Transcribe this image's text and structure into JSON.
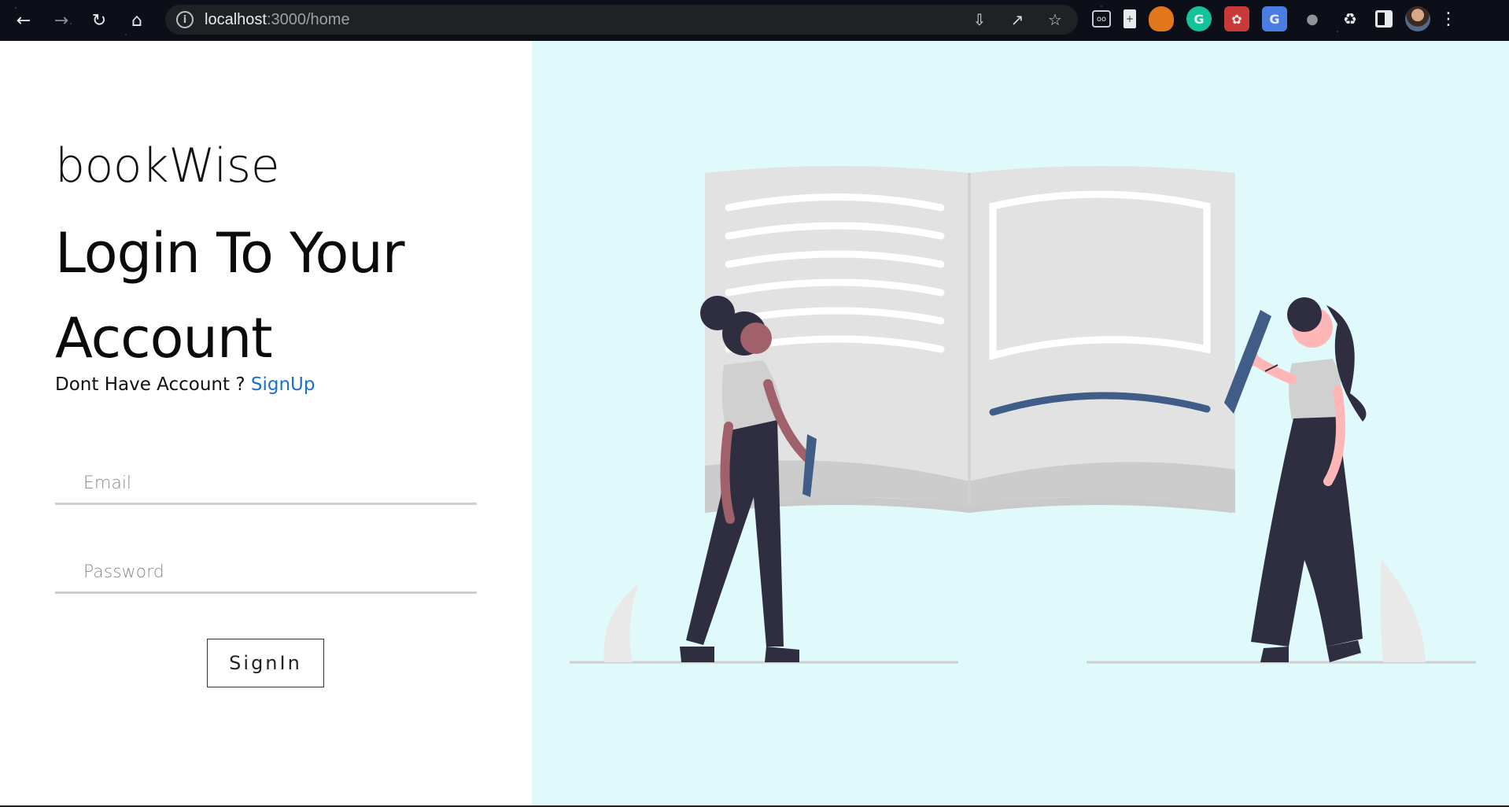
{
  "browser": {
    "url_host": "localhost",
    "url_path": ":3000/home",
    "extensions": [
      "reader-icon",
      "doc-icon",
      "metamask-icon",
      "grammarly-icon",
      "octo-icon",
      "translate-icon",
      "bug-icon",
      "puzzle-icon",
      "sidepanel-icon"
    ]
  },
  "login": {
    "brand": "bookWise",
    "heading": "Login To Your Account",
    "signup_prompt": "Dont Have Account ? ",
    "signup_link": "SignUp",
    "email_placeholder": "Email",
    "password_placeholder": "Password",
    "signin_label": "SignIn"
  },
  "colors": {
    "link": "#1a6fd6",
    "illustration_bg": "#e0f9fa",
    "accent_blue": "#3f5d87",
    "dark_figure": "#2f2e41"
  }
}
